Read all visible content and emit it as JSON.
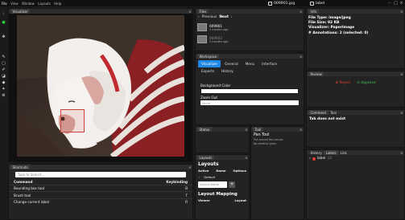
{
  "menubar": {
    "items": [
      "File",
      "View",
      "Window",
      "Layouts",
      "Help"
    ],
    "filename": "009901.jpg",
    "label": "label"
  },
  "panels": {
    "visualizer": "Visualizer",
    "files": "Files",
    "info": "Info",
    "workspace": "Workspace",
    "review": "Review",
    "comment": "Comment",
    "tool_tab": "Tool",
    "shortcuts": "Shortcuts",
    "status": "Status",
    "tool": "Tool",
    "layouts": "Layouts",
    "history": "History",
    "labels": "Labels",
    "link": "Link"
  },
  "files": {
    "prev": "Previous",
    "next": "Next",
    "items": [
      {
        "name": "009901",
        "meta": "5 months ago"
      },
      {
        "name": "009902",
        "meta": "5 months ago"
      }
    ]
  },
  "info": {
    "file_type": "File Type: image/jpeg",
    "file_size": "File Size: 92 KB",
    "visualizer": "Visualizer: PaperImage",
    "annotations": "# Annotations: 2 (selected: 0)"
  },
  "workspace": {
    "tabs": [
      "Visualizer",
      "General",
      "Menu",
      "Interface"
    ],
    "tabs2": [
      "Exports",
      "History"
    ],
    "bg_label": "Background Color",
    "zoom_label": "Zoom Out",
    "zoom_placeholder": "zoom"
  },
  "review": {
    "reject": "Reject",
    "approve": "Approve"
  },
  "comment": {
    "text": "Tab does not exist"
  },
  "shortcuts": {
    "search_placeholder": "Type to Search...",
    "col_command": "Command",
    "col_keybinding": "Keybinding",
    "rows": [
      {
        "command": "Bounding box tool",
        "key": "B"
      },
      {
        "command": "Brush tool",
        "key": "T"
      },
      {
        "command": "Change current label",
        "key": "R"
      }
    ]
  },
  "tool": {
    "title": "Pan Tool",
    "desc": "Pan around the canvas",
    "desc2": "No shortcut given"
  },
  "layouts": {
    "title": "Layouts",
    "cols": [
      "Active",
      "Name",
      "Options"
    ],
    "default_name": "Default",
    "name_placeholder": "Layout Name",
    "plus": "+",
    "mapping_title": "Layout Mapping",
    "mapping_cols": [
      "Viewer",
      "Layout"
    ]
  },
  "labels": {
    "items": [
      {
        "name": "label",
        "count": "(2)"
      }
    ]
  }
}
